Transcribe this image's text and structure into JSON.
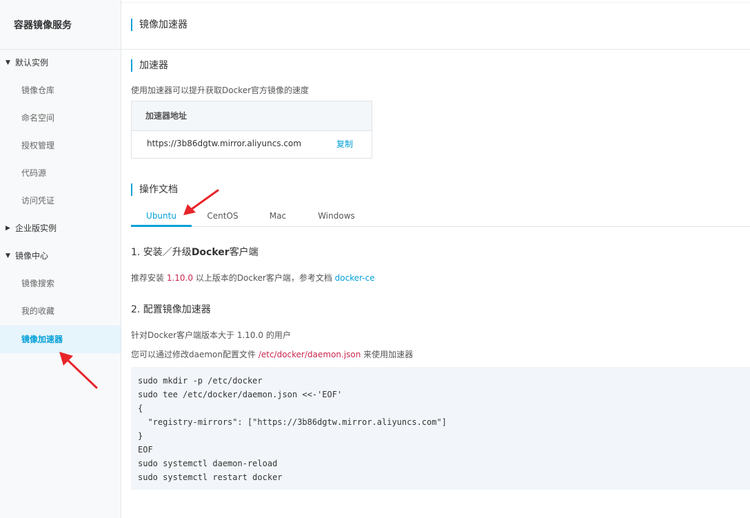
{
  "sidebar": {
    "title": "容器镜像服务",
    "items": [
      {
        "label": "默认实例",
        "type": "group",
        "expanded": true
      },
      {
        "label": "镜像仓库",
        "type": "sub"
      },
      {
        "label": "命名空间",
        "type": "sub"
      },
      {
        "label": "授权管理",
        "type": "sub"
      },
      {
        "label": "代码源",
        "type": "sub"
      },
      {
        "label": "访问凭证",
        "type": "sub"
      },
      {
        "label": "企业版实例",
        "type": "group",
        "expanded": false
      },
      {
        "label": "镜像中心",
        "type": "group",
        "expanded": true
      },
      {
        "label": "镜像搜索",
        "type": "sub"
      },
      {
        "label": "我的收藏",
        "type": "sub"
      },
      {
        "label": "镜像加速器",
        "type": "sub",
        "active": true
      }
    ]
  },
  "header": {
    "title": "镜像加速器"
  },
  "accelerator": {
    "section_title": "加速器",
    "description": "使用加速器可以提升获取Docker官方镜像的速度",
    "box_header": "加速器地址",
    "url": "https://3b86dgtw.mirror.aliyuncs.com",
    "copy_label": "复制"
  },
  "docs": {
    "section_title": "操作文档",
    "tabs": [
      "Ubuntu",
      "CentOS",
      "Mac",
      "Windows"
    ],
    "active_tab": "Ubuntu"
  },
  "step1": {
    "title_prefix": "1. 安装／升级",
    "title_bold": "Docker",
    "title_suffix": "客户端",
    "text_a": "推荐安装 ",
    "version": "1.10.0",
    "text_b": " 以上版本的Docker客户端，参考文档 ",
    "doc_link": "docker-ce"
  },
  "step2": {
    "title": "2. 配置镜像加速器",
    "line1": "针对Docker客户端版本大于 1.10.0 的用户",
    "line2_a": "您可以通过修改daemon配置文件 ",
    "line2_path": "/etc/docker/daemon.json",
    "line2_b": " 来使用加速器",
    "code": [
      "sudo mkdir -p /etc/docker",
      "sudo tee /etc/docker/daemon.json <<-'EOF'",
      "{",
      "  \"registry-mirrors\": [\"https://3b86dgtw.mirror.aliyuncs.com\"]",
      "}",
      "EOF",
      "sudo systemctl daemon-reload",
      "sudo systemctl restart docker"
    ]
  },
  "colors": {
    "accent": "#00a0d8",
    "annotation_arrow": "#e8242a",
    "brand": "#ff6a00"
  }
}
